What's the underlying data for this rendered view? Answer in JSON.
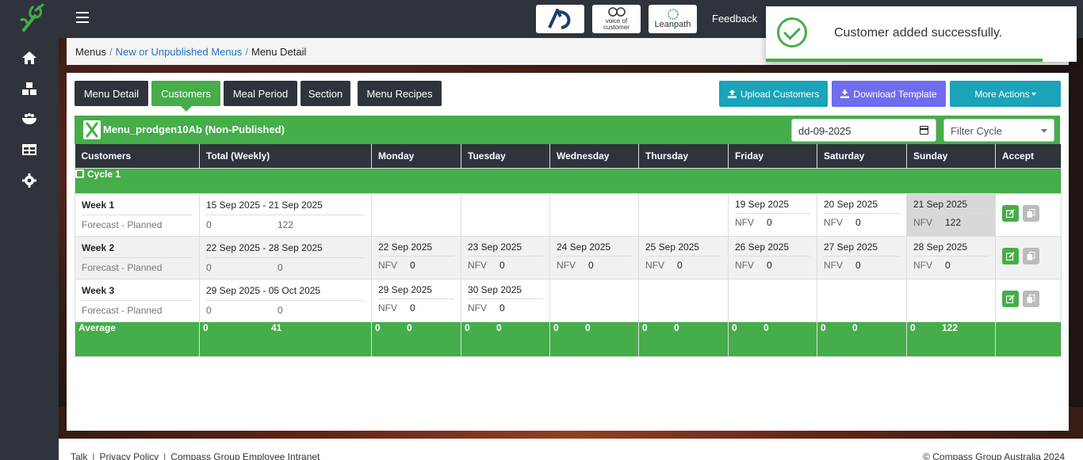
{
  "header": {
    "feedback_label": "Feedback",
    "partners": [
      {
        "name": "AD",
        "label": "AD"
      },
      {
        "name": "voice-of-customer",
        "label": "voice of customer"
      },
      {
        "name": "leanpath",
        "label": "Leanpath"
      }
    ]
  },
  "sidebar": {
    "items": [
      {
        "icon": "home-icon"
      },
      {
        "icon": "boxes-icon"
      },
      {
        "icon": "food-bowl-icon"
      },
      {
        "icon": "table-icon"
      },
      {
        "icon": "gear-icon"
      }
    ]
  },
  "breadcrumb": {
    "root": "Menus",
    "middle": "New or Unpublished Menus",
    "current": "Menu Detail"
  },
  "tabs": [
    "Menu Detail",
    "Customers",
    "Meal Period",
    "Section",
    "Menu Recipes"
  ],
  "actions": {
    "upload": "Upload Customers",
    "download": "Download Template",
    "more": "More Actions"
  },
  "menu": {
    "title": "Menu_prodgen10Ab (Non-Published)",
    "date_value": "dd-09-2025",
    "filter_placeholder": "Filter Cycle"
  },
  "table": {
    "headers": [
      "Customers",
      "Total (Weekly)",
      "Monday",
      "Tuesday",
      "Wednesday",
      "Thursday",
      "Friday",
      "Saturday",
      "Sunday",
      "Accept"
    ],
    "cycle_label": "Cycle 1",
    "weeks": [
      {
        "name": "Week 1",
        "sub": "Forecast - Planned",
        "range": "15 Sep 2025 - 21 Sep 2025",
        "total_a": "0",
        "total_b": "122",
        "days": [
          null,
          null,
          null,
          null,
          {
            "date": "19 Sep 2025",
            "label": "NFV",
            "value": "0"
          },
          {
            "date": "20 Sep 2025",
            "label": "NFV",
            "value": "0"
          },
          {
            "date": "21 Sep 2025",
            "label": "NFV",
            "value": "122"
          }
        ]
      },
      {
        "name": "Week 2",
        "sub": "Forecast - Planned",
        "range": "22 Sep 2025 - 28 Sep 2025",
        "total_a": "0",
        "total_b": "0",
        "days": [
          {
            "date": "22 Sep 2025",
            "label": "NFV",
            "value": "0"
          },
          {
            "date": "23 Sep 2025",
            "label": "NFV",
            "value": "0"
          },
          {
            "date": "24 Sep 2025",
            "label": "NFV",
            "value": "0"
          },
          {
            "date": "25 Sep 2025",
            "label": "NFV",
            "value": "0"
          },
          {
            "date": "26 Sep 2025",
            "label": "NFV",
            "value": "0"
          },
          {
            "date": "27 Sep 2025",
            "label": "NFV",
            "value": "0"
          },
          {
            "date": "28 Sep 2025",
            "label": "NFV",
            "value": "0"
          }
        ]
      },
      {
        "name": "Week 3",
        "sub": "Forecast - Planned",
        "range": "29 Sep 2025 - 05 Oct 2025",
        "total_a": "0",
        "total_b": "0",
        "days": [
          {
            "date": "29 Sep 2025",
            "label": "NFV",
            "value": "0"
          },
          {
            "date": "30 Sep 2025",
            "label": "NFV",
            "value": "0"
          },
          null,
          null,
          null,
          null,
          null
        ]
      }
    ],
    "average": {
      "label": "Average",
      "total": [
        "0",
        "41"
      ],
      "days": [
        [
          "0",
          "0"
        ],
        [
          "0",
          "0"
        ],
        [
          "0",
          "0"
        ],
        [
          "0",
          "0"
        ],
        [
          "0",
          "0"
        ],
        [
          "0",
          "0"
        ],
        [
          "0",
          "122"
        ]
      ]
    }
  },
  "toast": {
    "message": "Customer added successfully."
  },
  "footer": {
    "links": [
      "Talk",
      "Privacy Policy",
      "Compass Group Employee Intranet"
    ],
    "copyright": "© Compass Group Australia 2024"
  },
  "colors": {
    "primary_green": "#45ad49",
    "dark": "#2f333b",
    "teal": "#1aa3b9",
    "purple": "#6f6cf0",
    "link_blue": "#2273c8"
  }
}
